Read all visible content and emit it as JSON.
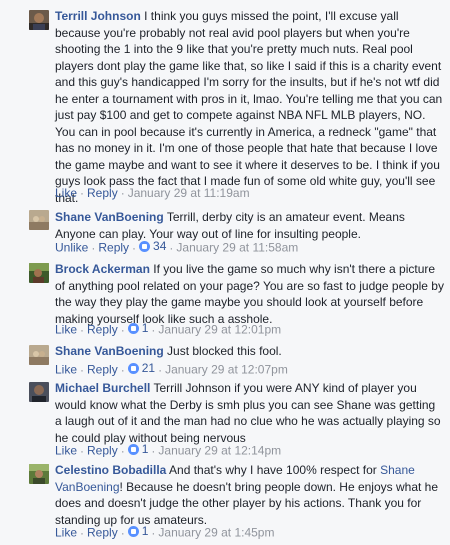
{
  "comments": [
    {
      "author": "Terrill Johnson",
      "text": "I think you guys missed the point, I'll excuse yall because you're probably not real avid pool players but when you're shooting the 1 into the 9 like that you're pretty much nuts. Real pool players dont play the game like that, so like I said if this is a charity event and this guy's handicapped I'm sorry for the insults, but if he's not wtf did he enter a tournament with pros in it, lmao. You're telling me that you can just pay $100 and get to compete against NBA NFL MLB players, NO. You can in pool because it's currently in America, a redneck \"game\" that has no money in it. I'm one of those people that hate that because I love the game maybe and want to see it where it deserves to be. I think if you guys look pass the fact that I made fun of some old white guy, you'll see that.",
      "like_label": "Like",
      "reply_label": "Reply",
      "time": "January 29 at 11:19am"
    },
    {
      "author": "Shane VanBoening",
      "text": "Terrill, derby city is an amateur event. Means Anyone can play. Your way out of line for insulting people.",
      "like_label": "Unlike",
      "reply_label": "Reply",
      "likes": "34",
      "time": "January 29 at 11:58am"
    },
    {
      "author": "Brock Ackerman",
      "text": "If you live the game so much why isn't there a picture of anything pool related on your page? You are so fast to judge people by the way they play the game maybe you should look at yourself before making yourself look like such a asshole.",
      "like_label": "Like",
      "reply_label": "Reply",
      "likes": "1",
      "time": "January 29 at 12:01pm"
    },
    {
      "author": "Shane VanBoening",
      "text": "Just blocked this fool.",
      "like_label": "Like",
      "reply_label": "Reply",
      "likes": "21",
      "time": "January 29 at 12:07pm"
    },
    {
      "author": "Michael Burchell",
      "text": "Terrill Johnson if you were ANY kind of player you would know what the Derby is smh plus you can see Shane was getting a laugh out of it and the man had no clue who he was actually playing so he could play without being nervous",
      "like_label": "Like",
      "reply_label": "Reply",
      "likes": "1",
      "time": "January 29 at 12:14pm"
    },
    {
      "author": "Celestino Bobadilla",
      "text_before": "And that's why I have 100% respect for",
      "mention": "Shane VanBoening",
      "text_after": "! Because he doesn't bring people down. He enjoys what he does and doesn't judge the other player by his actions. Thank you for standing up for us amateurs.",
      "like_label": "Like",
      "reply_label": "Reply",
      "likes": "1",
      "time": "January 29 at 1:45pm"
    }
  ],
  "colors": {
    "background": "#f6f7f9",
    "link": "#365899",
    "meta": "#90949c",
    "text": "#1d2129",
    "like_badge": "#5890ff"
  }
}
